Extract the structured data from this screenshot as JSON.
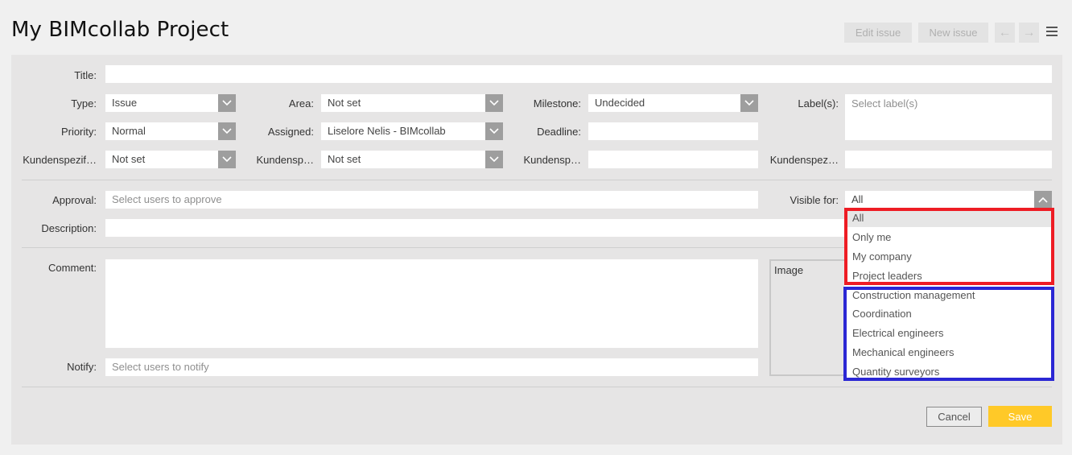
{
  "header": {
    "title": "My BIMcollab Project",
    "edit_issue": "Edit issue",
    "new_issue": "New issue",
    "prev_icon": "arrow-left-icon",
    "next_icon": "arrow-right-icon",
    "menu_icon": "hamburger-menu-icon"
  },
  "form": {
    "title": {
      "label": "Title:",
      "value": ""
    },
    "type": {
      "label": "Type:",
      "value": "Issue"
    },
    "area": {
      "label": "Area:",
      "value": "Not set"
    },
    "milestone": {
      "label": "Milestone:",
      "value": "Undecided"
    },
    "labels": {
      "label": "Label(s):",
      "placeholder": "Select label(s)"
    },
    "priority": {
      "label": "Priority:",
      "value": "Normal"
    },
    "assigned": {
      "label": "Assigned:",
      "value": "Liselore Nelis - BIMcollab"
    },
    "deadline": {
      "label": "Deadline:",
      "value": ""
    },
    "custom1": {
      "label": "Kundenspezif…",
      "value": "Not set"
    },
    "custom2": {
      "label": "Kundensp…",
      "value": "Not set"
    },
    "custom3": {
      "label": "Kundensp…",
      "value": ""
    },
    "custom4": {
      "label": "Kundenspez…",
      "value": ""
    },
    "approval": {
      "label": "Approval:",
      "placeholder": "Select users to approve"
    },
    "visible_for": {
      "label": "Visible for:",
      "value": "All"
    },
    "description": {
      "label": "Description:",
      "value": ""
    },
    "comment": {
      "label": "Comment:",
      "value": ""
    },
    "image": {
      "label": "Image"
    },
    "notify": {
      "label": "Notify:",
      "placeholder": "Select users to notify"
    }
  },
  "visible_for_dropdown": {
    "general": [
      "All",
      "Only me",
      "My company",
      "Project leaders"
    ],
    "roles": [
      "Construction management",
      "Coordination",
      "Electrical engineers",
      "Mechanical engineers",
      "Quantity surveyors"
    ],
    "highlight_colors": {
      "general": "#ee1c24",
      "roles": "#2b27d4"
    }
  },
  "actions": {
    "cancel": "Cancel",
    "save": "Save",
    "save_color": "#ffc928"
  }
}
